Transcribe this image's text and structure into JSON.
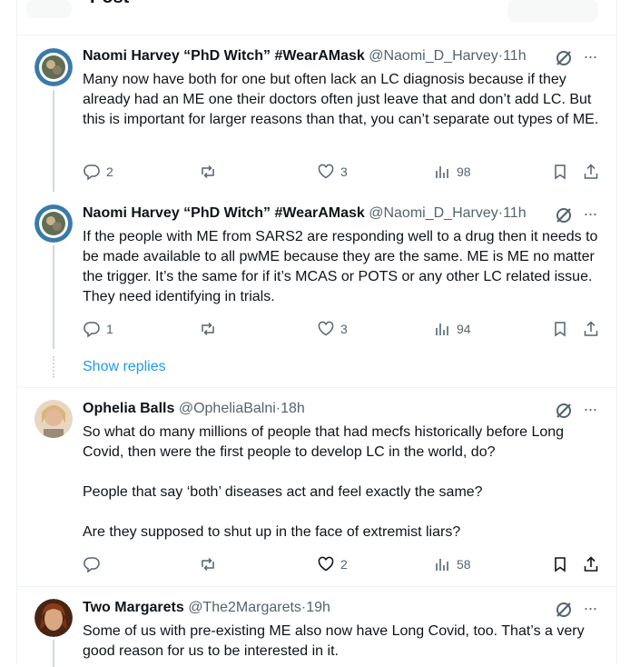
{
  "top_bar": {
    "title": "Post"
  },
  "posts": [
    {
      "name": "Naomi Harvey “PhD Witch” #WearAMask",
      "handle": "@Naomi_D_Harvey",
      "separator": "·",
      "time": "11h",
      "paragraphs": [
        "Many now have both for one but often lack an LC diagnosis because if they already had an ME one their doctors often just leave that and don’t add LC. But this is important for larger reasons than that, you can’t separate out types of ME."
      ],
      "replies": "2",
      "reposts": "",
      "likes": "3",
      "views": "98",
      "more": "···"
    },
    {
      "name": "Naomi Harvey “PhD Witch” #WearAMask",
      "handle": "@Naomi_D_Harvey",
      "separator": "·",
      "time": "11h",
      "paragraphs": [
        "If the people with ME from SARS2 are responding well to a drug then it needs to be made available to all pwME because they are the same. ME is ME no matter the trigger. It’s the same for if it’s MCAS or POTS or any other LC related issue. They need identifying in trials."
      ],
      "replies": "1",
      "reposts": "",
      "likes": "3",
      "views": "94",
      "more": "···"
    },
    {
      "name": "Ophelia Balls",
      "handle": "@OpheliaBalni",
      "separator": "·",
      "time": "18h",
      "paragraphs": [
        "So what do many millions of people that had mecfs historically before Long Covid, then were the first people to develop LC in the world, do?",
        "People that say ‘both’ diseases act and feel exactly the same?",
        "Are they supposed to shut up in the face of extremist liars?"
      ],
      "replies": "",
      "reposts": "",
      "likes": "2",
      "views": "58",
      "more": "···"
    },
    {
      "name": "Two Margarets",
      "handle": "@The2Margarets",
      "separator": "·",
      "time": "19h",
      "paragraphs": [
        "Some of us with pre-existing ME also now have Long Covid, too. That’s a very good reason for us to be interested in it."
      ],
      "more": "···"
    }
  ],
  "show_replies": "Show replies",
  "colors": {
    "link": "#1d9bf0",
    "muted": "#536471",
    "text": "#0f1419",
    "border": "#eff3f4"
  }
}
